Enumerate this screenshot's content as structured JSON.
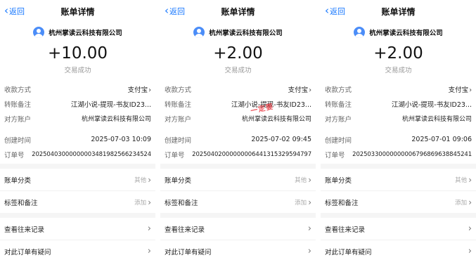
{
  "panels": [
    {
      "nav": {
        "back_label": "返回",
        "title": "账单详情"
      },
      "merchant": "杭州掌读云科技有限公司",
      "amount": "+10.00",
      "status": "交易成功",
      "fields": [
        {
          "label": "收款方式",
          "value": "支付宝"
        },
        {
          "label": "转账备注",
          "value": "江湖小说-提现-书友ID23..."
        },
        {
          "label": "对方账户",
          "value": "杭州掌读云科技有限公司"
        },
        {
          "label": "创建时间",
          "value": "2025-07-03 10:09"
        },
        {
          "label": "订单号",
          "value": "20250403000000003481982566234524"
        }
      ],
      "menu1": [
        {
          "label": "账单分类",
          "right": "其他"
        },
        {
          "label": "标签和备注",
          "right": "添加"
        }
      ],
      "menu2": [
        {
          "label": "查看往来记录"
        },
        {
          "label": "对此订单有疑问"
        }
      ],
      "stamp": ""
    },
    {
      "nav": {
        "back_label": "返回",
        "title": "账单详情"
      },
      "merchant": "杭州掌读云科技有限公司",
      "amount": "+2.00",
      "status": "交易成功",
      "fields": [
        {
          "label": "收款方式",
          "value": "支付宝"
        },
        {
          "label": "转账备注",
          "value": "江湖小说-提现-书友ID23..."
        },
        {
          "label": "对方账户",
          "value": "杭州掌读云科技有限公司"
        },
        {
          "label": "创建时间",
          "value": "2025-07-02 09:45"
        },
        {
          "label": "订单号",
          "value": "20250402000000006441315329594797"
        }
      ],
      "menu1": [
        {
          "label": "账单分类",
          "right": "其他"
        },
        {
          "label": "标签和备注",
          "right": "添加"
        }
      ],
      "menu2": [
        {
          "label": "查看往来记录"
        },
        {
          "label": "对此订单有疑问"
        }
      ],
      "stamp": "一定要"
    },
    {
      "nav": {
        "back_label": "返回",
        "title": "账单详情"
      },
      "merchant": "杭州掌读云科技有限公司",
      "amount": "+2.00",
      "status": "交易成功",
      "fields": [
        {
          "label": "收款方式",
          "value": "支付宝"
        },
        {
          "label": "转账备注",
          "value": "江湖小说-提现-书友ID23..."
        },
        {
          "label": "对方账户",
          "value": "杭州掌读云科技有限公司"
        },
        {
          "label": "创建时间",
          "value": "2025-07-01 09:06"
        },
        {
          "label": "订单号",
          "value": "20250330000000006796869638845241"
        }
      ],
      "menu1": [
        {
          "label": "账单分类",
          "right": "其他"
        },
        {
          "label": "标签和备注",
          "right": "添加"
        }
      ],
      "menu2": [
        {
          "label": "查看往来记录"
        },
        {
          "label": "对此订单有疑问"
        }
      ],
      "stamp": ""
    }
  ],
  "colors": {
    "accent": "#1677ff",
    "avatar": "#4b8df8",
    "stamp": "#e7252f"
  },
  "icons": {
    "back": "chevron-left-icon",
    "row_arrow": "chevron-right-icon"
  }
}
